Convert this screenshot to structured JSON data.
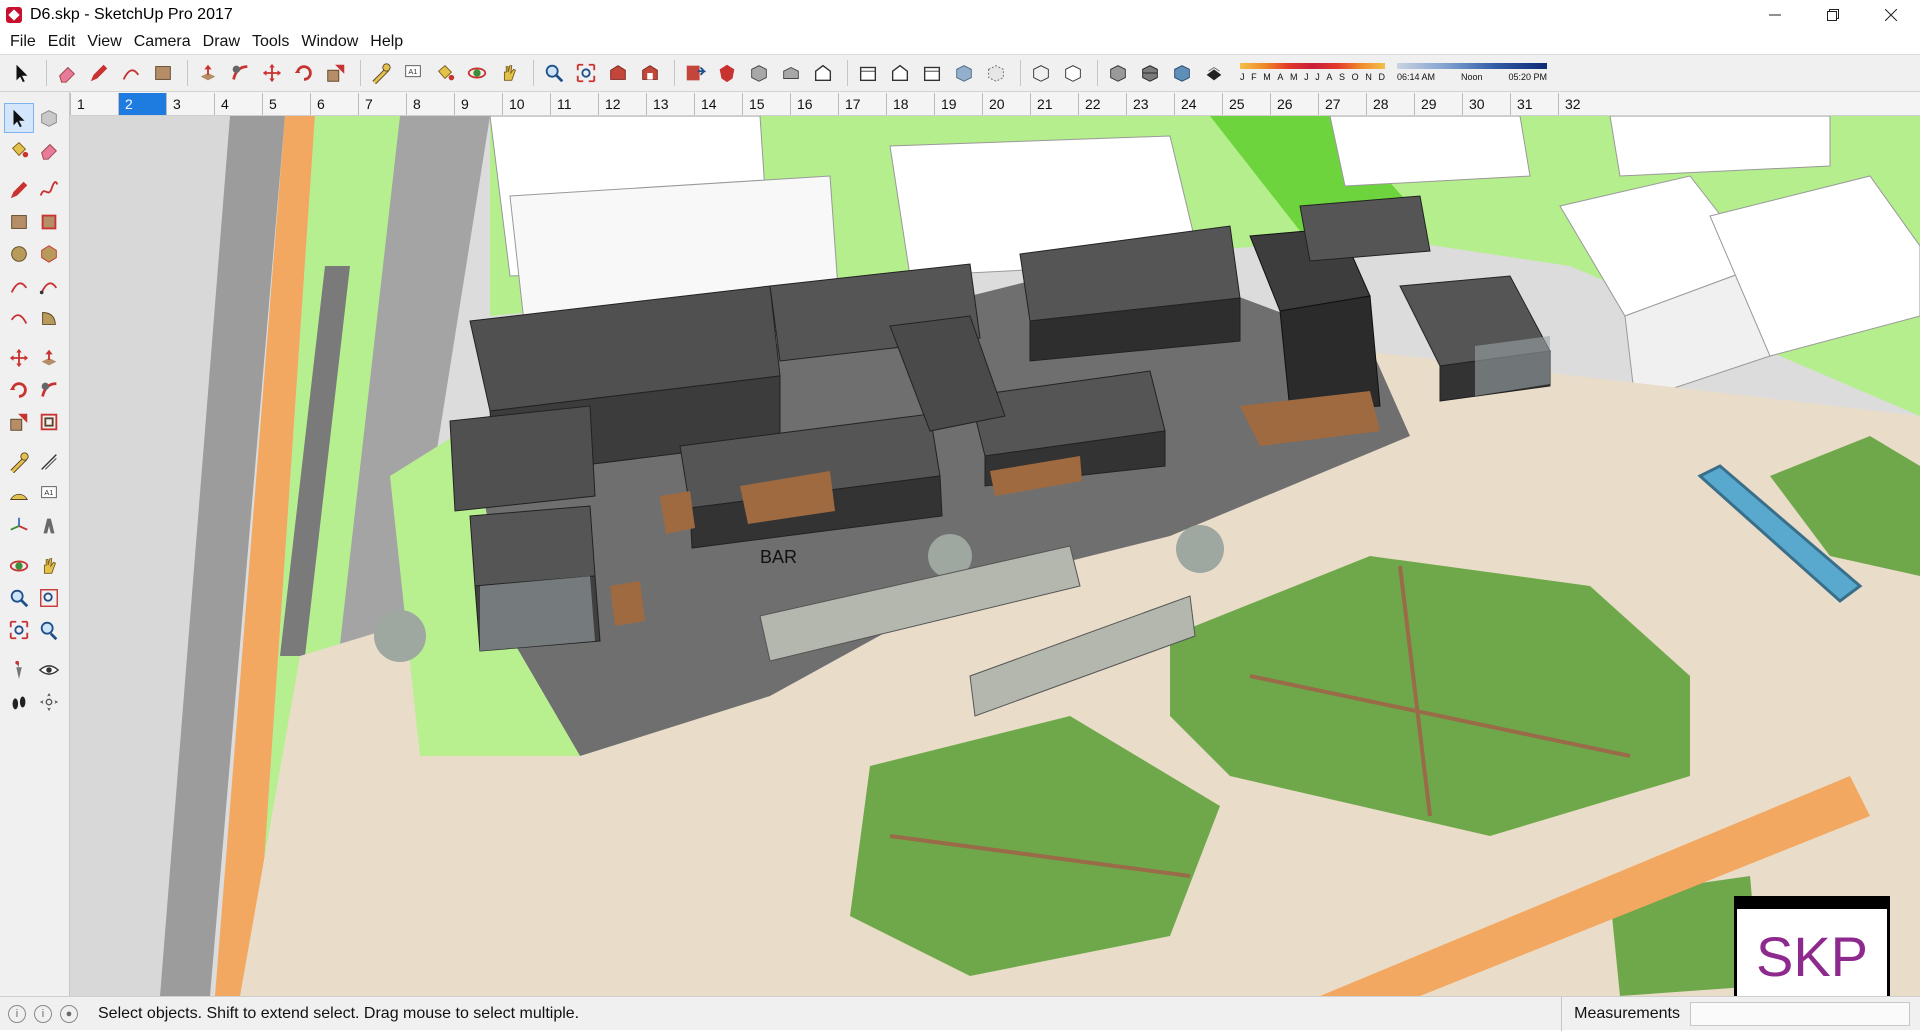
{
  "window": {
    "title": "D6.skp - SketchUp Pro 2017",
    "minimize_icon": "minimize-icon",
    "maximize_icon": "restore-icon",
    "close_icon": "close-icon"
  },
  "menu": {
    "items": [
      "File",
      "Edit",
      "View",
      "Camera",
      "Draw",
      "Tools",
      "Window",
      "Help"
    ]
  },
  "toolbar": {
    "icons": [
      "select-icon",
      "eraser-icon",
      "pencil-icon",
      "arc-icon",
      "rectangle-icon",
      "push-pull-icon",
      "follow-me-icon",
      "move-icon",
      "rotate-icon",
      "scale-icon",
      "tape-measure-icon",
      "text-icon",
      "paint-bucket-icon",
      "orbit-icon",
      "pan-icon",
      "zoom-icon",
      "zoom-extents-icon",
      "warehouse-icon",
      "extension-warehouse-icon",
      "send-to-layout-icon",
      "extension-manager-icon",
      "iso-view-icon",
      "top-view-icon",
      "front-view-icon",
      "right-view-icon",
      "back-view-icon",
      "left-view-icon",
      "xray-icon",
      "back-edges-icon",
      "wireframe-icon",
      "hidden-line-icon",
      "shaded-icon",
      "shaded-textures-icon",
      "monochrome-icon",
      "shadows-toggle-icon"
    ],
    "shadow_months": [
      "J",
      "F",
      "M",
      "A",
      "M",
      "J",
      "J",
      "A",
      "S",
      "O",
      "N",
      "D"
    ],
    "shadow_time_start": "06:14 AM",
    "shadow_time_mid": "Noon",
    "shadow_time_end": "05:20 PM"
  },
  "scenes": {
    "tabs": [
      "1",
      "2",
      "3",
      "4",
      "5",
      "6",
      "7",
      "8",
      "9",
      "10",
      "11",
      "12",
      "13",
      "14",
      "15",
      "16",
      "17",
      "18",
      "19",
      "20",
      "21",
      "22",
      "23",
      "24",
      "25",
      "26",
      "27",
      "28",
      "29",
      "30",
      "31",
      "32"
    ],
    "active": "2"
  },
  "palette": {
    "rows": [
      [
        "select-icon",
        "make-component-icon"
      ],
      [
        "paint-bucket-icon",
        "eraser-icon"
      ],
      [
        "gap"
      ],
      [
        "line-icon",
        "freehand-icon"
      ],
      [
        "rectangle-icon",
        "rotated-rectangle-icon"
      ],
      [
        "circle-icon",
        "polygon-icon"
      ],
      [
        "arc-icon",
        "two-point-arc-icon"
      ],
      [
        "three-point-arc-icon",
        "pie-icon"
      ],
      [
        "gap"
      ],
      [
        "move-icon",
        "push-pull-icon"
      ],
      [
        "rotate-icon",
        "follow-me-icon"
      ],
      [
        "scale-icon",
        "offset-icon"
      ],
      [
        "gap"
      ],
      [
        "tape-measure-icon",
        "dimension-icon"
      ],
      [
        "protractor-icon",
        "text-icon"
      ],
      [
        "axes-icon",
        "3d-text-icon"
      ],
      [
        "gap"
      ],
      [
        "orbit-icon",
        "pan-icon"
      ],
      [
        "zoom-icon",
        "zoom-window-icon"
      ],
      [
        "zoom-extents-icon",
        "previous-view-icon"
      ],
      [
        "gap"
      ],
      [
        "position-camera-icon",
        "look-around-icon"
      ],
      [
        "walk-icon",
        "section-plane-icon"
      ]
    ]
  },
  "viewport": {
    "sign_text": "BAR",
    "watermark": "SKP"
  },
  "status": {
    "message": "Select objects. Shift to extend select. Drag mouse to select multiple.",
    "measurements_label": "Measurements",
    "measurements_value": ""
  }
}
